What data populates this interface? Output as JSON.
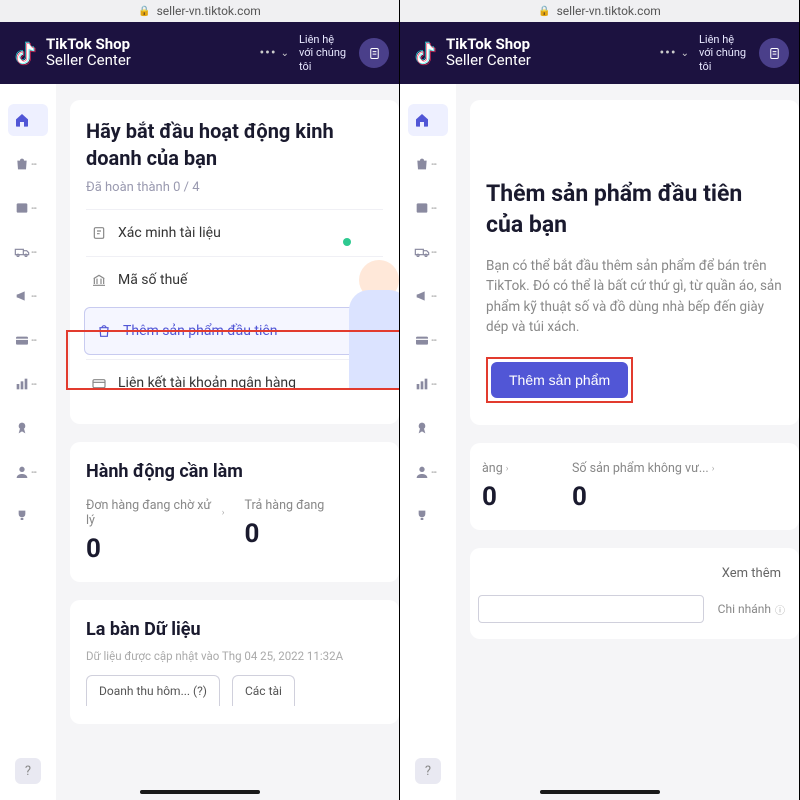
{
  "url": "seller-vn.tiktok.com",
  "brand": {
    "line1": "TikTok Shop",
    "line2": "Seller Center"
  },
  "header": {
    "contact": "Liên hệ với chúng tôi"
  },
  "left": {
    "onboard": {
      "title": "Hãy bắt đầu hoạt động kinh doanh của bạn",
      "progress": "Đã hoàn thành 0 / 4",
      "tasks": {
        "verify": "Xác minh tài liệu",
        "tax": "Mã số thuế",
        "addProduct": "Thêm sản phẩm đầu tiên",
        "bank": "Liên kết tài khoản ngân hàng"
      }
    },
    "todo": {
      "title": "Hành động cần làm",
      "m1_label": "Đơn hàng đang chờ xử lý",
      "m1_val": "0",
      "m2_label": "Trả hàng đang",
      "m2_val": "0"
    },
    "compass": {
      "title": "La bàn Dữ liệu",
      "updated": "Dữ liệu được cập nhật vào Thg 04 25, 2022 11:32A",
      "tab1": "Doanh thu hôm... (?)",
      "tab2": "Các tài"
    }
  },
  "right": {
    "product": {
      "title": "Thêm sản phẩm đầu tiên của bạn",
      "desc": "Bạn có thể bắt đầu thêm sản phẩm để bán trên TikTok. Đó có thể là bất cứ thứ gì, từ quần áo, sản phẩm kỹ thuật số và đồ dùng nhà bếp đến giày dép và túi xách.",
      "button": "Thêm sản phẩm"
    },
    "todo": {
      "m1_label": "àng",
      "m1_val": "0",
      "m2_label": "Số sản phẩm không vư...",
      "m2_val": "0"
    },
    "see_more": "Xem thêm",
    "branch": "Chi nhánh"
  }
}
